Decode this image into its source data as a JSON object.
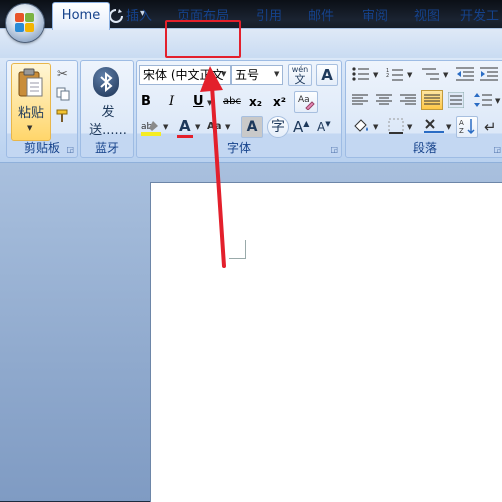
{
  "quick_access": {
    "save_icon": "save-icon",
    "undo_icon": "undo-icon",
    "redo_icon": "redo-icon"
  },
  "tabs": [
    {
      "label": "Home",
      "active": true
    },
    {
      "label": "插入"
    },
    {
      "label": "页面布局",
      "highlighted": true
    },
    {
      "label": "引用"
    },
    {
      "label": "邮件"
    },
    {
      "label": "审阅"
    },
    {
      "label": "视图"
    },
    {
      "label": "开发工"
    }
  ],
  "clipboard": {
    "paste_label": "粘贴",
    "group_label": "剪贴板"
  },
  "bluetooth": {
    "send_label_1": "发",
    "send_label_2": "送......",
    "group_label": "蓝牙"
  },
  "font": {
    "font_name": "宋体 (中文正文",
    "font_size": "五号",
    "wen_label": "wén",
    "bold": "B",
    "italic": "I",
    "underline": "U",
    "strike": "abc",
    "subscript": "x₂",
    "superscript": "x²",
    "font_color_letter": "A",
    "case_label": "Aa",
    "group_label": "字体"
  },
  "paragraph": {
    "group_label": "段落"
  },
  "colors": {
    "highlight_red": "#e3202c",
    "tab_text": "#15428b"
  }
}
